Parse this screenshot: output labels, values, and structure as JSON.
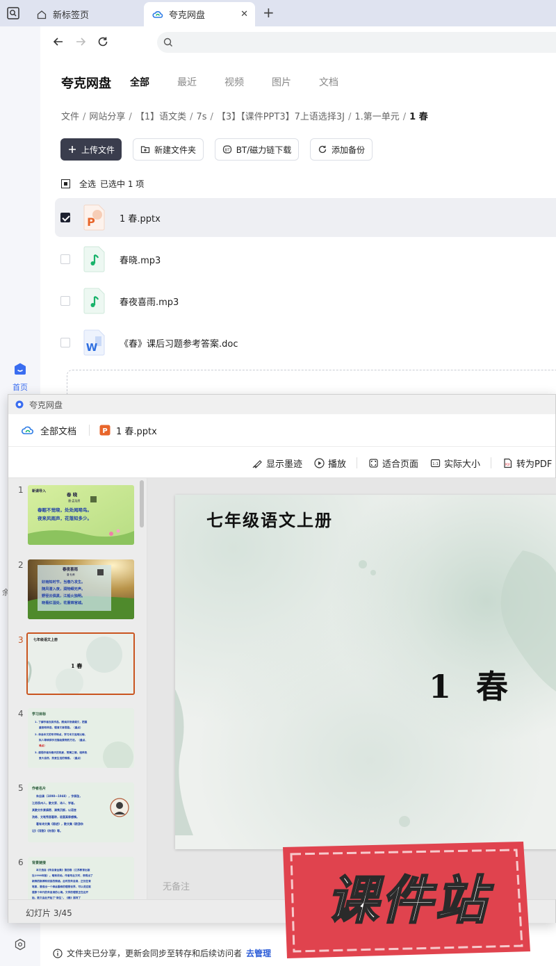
{
  "browser": {
    "tabs": [
      {
        "label": "新标签页"
      },
      {
        "label": "夸克网盘"
      }
    ]
  },
  "sidebar": {
    "home_label": "首页",
    "strip_char": "余"
  },
  "drive": {
    "app_title": "夸克网盘",
    "top_tabs": [
      "全部",
      "最近",
      "视频",
      "图片",
      "文档"
    ],
    "breadcrumb": [
      "文件",
      "网站分享",
      "【1】语文类",
      "7s",
      "【3】【课件PPT3】7上语选择3J",
      "1.第一单元",
      "1 春"
    ],
    "buttons": {
      "upload": "上传文件",
      "new_folder": "新建文件夹",
      "bt": "BT/磁力链下载",
      "backup": "添加备份"
    },
    "selection": {
      "select_all": "全选",
      "selected_text": "已选中  1  项"
    },
    "files": [
      {
        "name": "1 春.pptx",
        "type": "pptx",
        "checked": true
      },
      {
        "name": "春晓.mp3",
        "type": "mp3",
        "checked": false
      },
      {
        "name": "春夜喜雨.mp3",
        "type": "mp3",
        "checked": false
      },
      {
        "name": "《春》课后习题参考答案.doc",
        "type": "doc",
        "checked": false
      }
    ],
    "notice": {
      "text": "文件夹已分享，更新会同步至转存和后续访问者",
      "link": "去管理"
    }
  },
  "viewer": {
    "window_title": "夸克网盘",
    "all_docs": "全部文档",
    "file_name": "1 春.pptx",
    "toolbar": {
      "ink": "显示墨迹",
      "play": "播放",
      "fit_page": "适合页面",
      "actual_size": "实际大小",
      "to_pdf": "转为PDF"
    },
    "thumbnails": [
      {
        "num": "1",
        "title": "新课导入",
        "heading": "春 晓",
        "author": "唐·孟浩然",
        "lines": [
          "春眠不觉晓，处处闻啼鸟。",
          "夜来风雨声，花落知多少。"
        ]
      },
      {
        "num": "2",
        "heading": "春夜喜雨",
        "author": "唐·杜甫",
        "lines": [
          "好雨知时节，当春乃发生。",
          "随风潜入夜，润物细无声。",
          "野径云俱黑，江船火独明。",
          "晓看红湿处，花重锦官城。"
        ]
      },
      {
        "num": "3",
        "small_title": "七年级语文上册",
        "main": "1 春"
      },
      {
        "num": "4",
        "title": "学习目标",
        "lines": [
          "1. 了解作者及其作品，朗读并背诵课文，把握",
          "重音和停连，理清文章思路。（重点）",
          "2. 体会本文的写作特点，学习本文运用比喻、",
          "拟人等修辞手法描绘景物的方法。（重点、",
          "难点）",
          "3. 感悟作者对春天的热爱，赞美之情，培养热",
          "爱大自然、热爱生活的情感。（重点）"
        ]
      },
      {
        "num": "5",
        "title": "作者名片",
        "lines": [
          "朱自清（1898—1948），字佩弦，",
          "江苏扬州人，散文家、诗人、学者。",
          "其散文朴素缜密、清隽沉郁，以语言",
          "洗练、文笔秀丽著称，极富真挚感情。",
          "著有诗文集《踪迹》，散文集《欧游杂",
          "记》《背影》《你我》等。"
        ]
      },
      {
        "num": "6",
        "title": "背景链接",
        "lines": [
          "本文选自《朱自清全集》第四卷（江苏教育出版",
          "社1996年版）。略有改动。作者写此文时，表现出了",
          "新鲜的脉搏和欣喜的情绪。此时的朱自清，正处在青",
          "笔意，营造出一个柳丝垂柳的理想世界，可以说这就",
          "是那个年代的朱自清的心境。文学的理想正在此开",
          "始，散文由此开始了\"新生\"。《春》描写了"
        ]
      }
    ],
    "slide": {
      "small_title": "七年级语文上册",
      "main_title": "1  春"
    },
    "notes": "无备注",
    "footer": "幻灯片 3/45"
  },
  "watermark": {
    "text": "课件站"
  },
  "colors": {
    "accent_orange": "#c9541f",
    "link_blue": "#2a5bd7",
    "primary_dark": "#3a3d4d",
    "watermark_red": "#e0434e",
    "ppt_orange": "#e8662b",
    "audio_green": "#19b36b",
    "word_blue": "#2f6fe0"
  }
}
